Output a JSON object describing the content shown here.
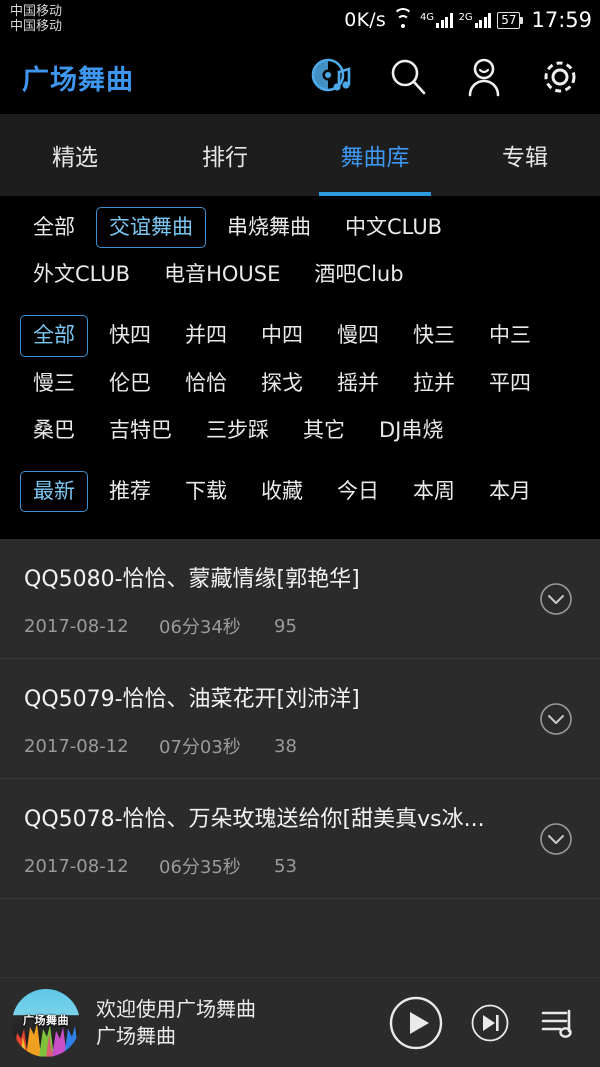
{
  "statusbar": {
    "carrier1": "中国移动",
    "carrier2": "中国移动",
    "netspeed": "0K/s",
    "net1_label": "4G",
    "net2_label": "2G",
    "battery": "57",
    "time": "17:59",
    "icons": [
      "wifi-icon",
      "signal-bars-icon",
      "battery-icon"
    ]
  },
  "header": {
    "title": "广场舞曲",
    "accent_color": "#3d97f0",
    "actions": [
      {
        "name": "music-disc-icon"
      },
      {
        "name": "search-icon"
      },
      {
        "name": "user-icon"
      },
      {
        "name": "gear-icon"
      }
    ]
  },
  "tabs": [
    {
      "label": "精选",
      "active": false
    },
    {
      "label": "排行",
      "active": false
    },
    {
      "label": "舞曲库",
      "active": true
    },
    {
      "label": "专辑",
      "active": false
    }
  ],
  "filters": {
    "category": {
      "items": [
        "全部",
        "交谊舞曲",
        "串烧舞曲",
        "中文CLUB",
        "外文CLUB",
        "电音HOUSE",
        "酒吧Club"
      ],
      "selected": "交谊舞曲"
    },
    "style": {
      "items": [
        "全部",
        "快四",
        "并四",
        "中四",
        "慢四",
        "快三",
        "中三",
        "慢三",
        "伦巴",
        "恰恰",
        "探戈",
        "摇并",
        "拉并",
        "平四",
        "桑巴",
        "吉特巴",
        "三步踩",
        "其它",
        "DJ串烧"
      ],
      "selected": "全部"
    },
    "sort": {
      "items": [
        "最新",
        "推荐",
        "下载",
        "收藏",
        "今日",
        "本周",
        "本月"
      ],
      "selected": "最新"
    }
  },
  "songs": [
    {
      "name": "QQ5080-恰恰、蒙藏情缘[郭艳华]",
      "date": "2017-08-12",
      "duration": "06分34秒",
      "count": "95"
    },
    {
      "name": "QQ5079-恰恰、油菜花开[刘沛洋]",
      "date": "2017-08-12",
      "duration": "07分03秒",
      "count": "38"
    },
    {
      "name": "QQ5078-恰恰、万朵玫瑰送给你[甜美真vs冰...",
      "date": "2017-08-12",
      "duration": "06分35秒",
      "count": "53"
    }
  ],
  "player": {
    "art_caption": "广场舞曲",
    "title": "欢迎使用广场舞曲",
    "subtitle": "广场舞曲",
    "controls": [
      {
        "name": "play-button"
      },
      {
        "name": "next-track-button"
      },
      {
        "name": "playlist-button"
      }
    ]
  }
}
